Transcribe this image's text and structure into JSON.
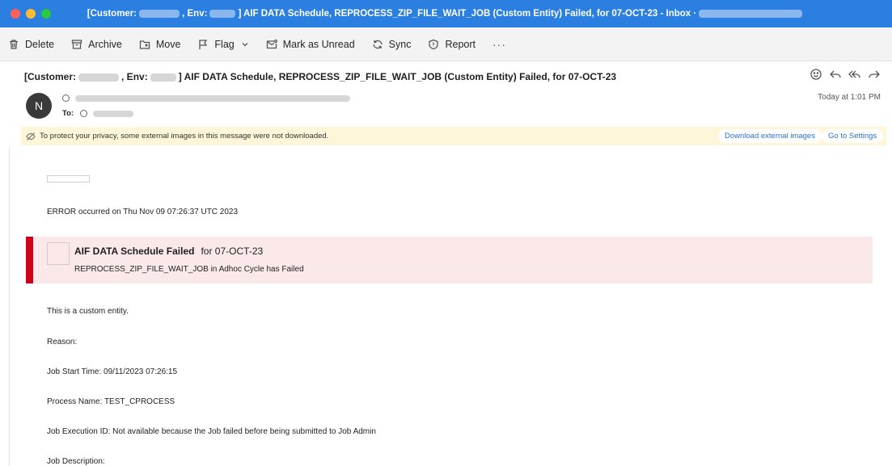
{
  "window": {
    "title_prefix": "[Customer:",
    "title_env": ", Env:",
    "title_main": "] AIF DATA Schedule, REPROCESS_ZIP_FILE_WAIT_JOB (Custom Entity) Failed, for 07-OCT-23 - Inbox ·"
  },
  "toolbar": {
    "delete": "Delete",
    "archive": "Archive",
    "move": "Move",
    "flag": "Flag",
    "mark_unread": "Mark as Unread",
    "sync": "Sync",
    "report": "Report",
    "more": "···"
  },
  "message": {
    "subject_prefix": "[Customer:",
    "subject_env": ", Env:",
    "subject_main": "] AIF DATA Schedule, REPROCESS_ZIP_FILE_WAIT_JOB (Custom Entity) Failed, for 07-OCT-23",
    "avatar_initial": "N",
    "to_label": "To:",
    "date": "Today at 1:01 PM"
  },
  "privacy": {
    "text": "To protect your privacy, some external images in this message were not downloaded.",
    "download_button": "Download external images",
    "settings_button": "Go to Settings"
  },
  "body": {
    "error_line": "ERROR occurred on Thu Nov 09 07:26:37 UTC 2023",
    "alert_title": "AIF DATA Schedule Failed",
    "alert_for": "for 07-OCT-23",
    "alert_detail": "REPROCESS_ZIP_FILE_WAIT_JOB in Adhoc Cycle has Failed",
    "line_custom_entity": "This is a custom entity.",
    "line_reason": "Reason:",
    "line_start_time": "Job Start Time: 09/11/2023 07:26:15",
    "line_process_name": "Process Name: TEST_CPROCESS",
    "line_execution_id": "Job Execution ID: Not available because the Job failed before being submitted to Job Admin",
    "line_description": "Job Description:"
  },
  "colors": {
    "titlebar": "#2a7fe0",
    "alert_bar": "#d0021b",
    "alert_bg": "#fbe9e9",
    "privacy_bg": "#fdf6d8",
    "link": "#2a72d8"
  }
}
